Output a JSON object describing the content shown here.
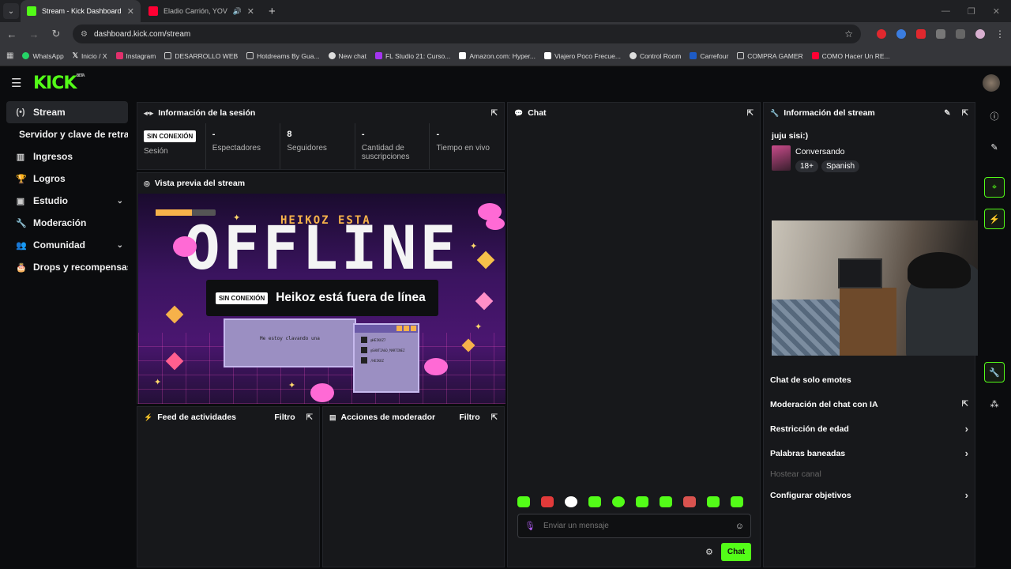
{
  "browser": {
    "tabs": [
      {
        "title": "Stream - Kick Dashboard",
        "active": true,
        "color": "#53fc18"
      },
      {
        "title": "Eladio Carrión, YOVNGCHIM",
        "active": false,
        "color": "#ff0033"
      }
    ],
    "url": "dashboard.kick.com/stream",
    "bookmarks": [
      {
        "label": "WhatsApp",
        "color": "#25d366"
      },
      {
        "label": "Inicio / X",
        "color": "#ffffff"
      },
      {
        "label": "Instagram",
        "color": "#e1306c"
      },
      {
        "label": "DESARROLLO WEB",
        "color": "#cccccc"
      },
      {
        "label": "Hotdreams By Gua...",
        "color": "#cccccc"
      },
      {
        "label": "New chat",
        "color": "#dddddd"
      },
      {
        "label": "FL Studio 21: Curso...",
        "color": "#a435f0"
      },
      {
        "label": "Amazon.com: Hyper...",
        "color": "#ffffff"
      },
      {
        "label": "Viajero Poco Frecue...",
        "color": "#ffffff"
      },
      {
        "label": "Control Room",
        "color": "#dddddd"
      },
      {
        "label": "Carrefour",
        "color": "#1e5bc6"
      },
      {
        "label": "COMPRA GAMER",
        "color": "#dddddd"
      },
      {
        "label": "COMO Hacer Un RE...",
        "color": "#ff0033"
      }
    ]
  },
  "app": {
    "logo": "KICK",
    "beta": "BETA",
    "accent": "#53fc18"
  },
  "sidebar": {
    "items": [
      {
        "label": "Stream",
        "icon": "broadcast-icon"
      },
      {
        "label": "Servidor y clave de retransmisión",
        "icon": ""
      },
      {
        "label": "Ingresos",
        "icon": "chart-icon"
      },
      {
        "label": "Logros",
        "icon": "trophy-icon"
      },
      {
        "label": "Estudio",
        "icon": "studio-icon"
      },
      {
        "label": "Moderación",
        "icon": "wrench-icon"
      },
      {
        "label": "Comunidad",
        "icon": "users-icon"
      },
      {
        "label": "Drops y recompensas",
        "icon": "gift-icon"
      }
    ]
  },
  "session": {
    "title": "Información de la sesión",
    "status_badge": "SIN CONEXIÓN",
    "status_label": "Sesión",
    "stats": [
      {
        "value": "-",
        "label": "Espectadores"
      },
      {
        "value": "8",
        "label": "Seguidores"
      },
      {
        "value": "-",
        "label": "Cantidad de suscripciones"
      },
      {
        "value": "-",
        "label": "Tiempo en vivo"
      }
    ]
  },
  "preview": {
    "title": "Vista previa del stream",
    "banner_small": "HEIKOZ ESTA",
    "banner_big": "OFFLINE",
    "badge": "SIN CONEXIÓN",
    "message": "Heikoz está fuera de línea",
    "window_text": "Me estoy clavando una",
    "social": [
      "@HEIKOZ7",
      "@SANTIAGO_MARTINEZ",
      "/HEIKOZ"
    ]
  },
  "feed": {
    "title": "Feed de actividades",
    "filter": "Filtro"
  },
  "mod_actions": {
    "title": "Acciones de moderador",
    "filter": "Filtro"
  },
  "chat": {
    "title": "Chat",
    "placeholder": "Enviar un mensaje",
    "send_label": "Chat",
    "emotes": [
      "#53fc18",
      "#e23a3a",
      "#ffffff",
      "#53fc18",
      "#53fc18",
      "#53fc18",
      "#53fc18",
      "#d9534f",
      "#53fc18",
      "#53fc18"
    ]
  },
  "stream_info": {
    "title": "Información del stream",
    "stream_title": "juju sisi:)",
    "category": "Conversando",
    "tags": [
      "18+",
      "Spanish"
    ],
    "menu": [
      {
        "label": "Chat de solo emotes",
        "type": "toggle"
      },
      {
        "label": "Moderación del chat con IA",
        "type": "popout"
      },
      {
        "label": "Restricción de edad",
        "type": "arrow"
      },
      {
        "label": "Palabras baneadas",
        "type": "arrow"
      },
      {
        "label": "Hostear canal",
        "type": "disabled"
      },
      {
        "label": "Configurar objetivos",
        "type": "arrow"
      }
    ]
  }
}
